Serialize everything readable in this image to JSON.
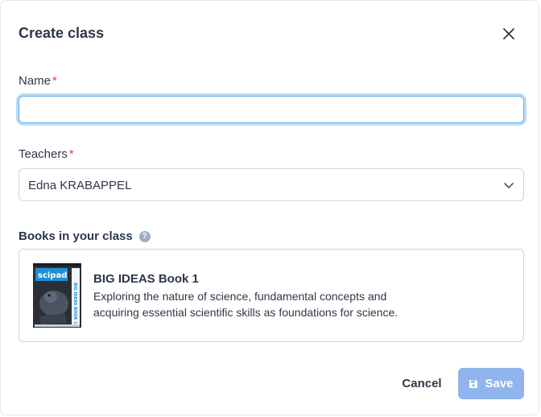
{
  "dialog": {
    "title": "Create class"
  },
  "form": {
    "name": {
      "label": "Name",
      "required_mark": "*",
      "value": "",
      "placeholder": ""
    },
    "teachers": {
      "label": "Teachers",
      "required_mark": "*",
      "selected": "Edna KRABAPPEL"
    },
    "books": {
      "label": "Books in your class",
      "help_glyph": "?",
      "items": [
        {
          "title": "BIG IDEAS Book 1",
          "description": "Exploring the nature of science, fundamental concepts and acquiring essential scientific skills as foundations for science.",
          "cover": {
            "brand": "scipad",
            "spine_text": "BIG IDEAS BOOK 1"
          }
        }
      ]
    }
  },
  "actions": {
    "cancel_label": "Cancel",
    "save_label": "Save"
  },
  "colors": {
    "accent": "#90b4ec",
    "required": "#e53e3e",
    "focus": "#63b3ed",
    "text": "#2d3748"
  },
  "icons": {
    "close": "close-icon",
    "chevron": "chevron-down-icon",
    "help": "question-circle-icon",
    "save": "floppy-disk-icon"
  }
}
